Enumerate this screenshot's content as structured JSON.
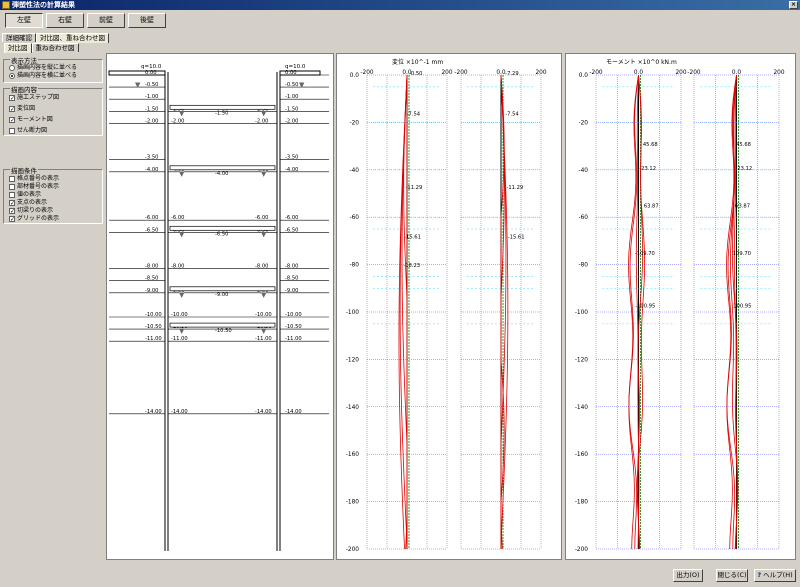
{
  "window": {
    "title": "弾塑性法の計算結果"
  },
  "walls": [
    "左壁",
    "右壁",
    "前壁",
    "後壁"
  ],
  "main_tabs": [
    "詳細確認",
    "対比図、重ね合わせ図"
  ],
  "sub_tabs": [
    "対比図",
    "重ね合わせ図"
  ],
  "display_method": {
    "title": "表示方法",
    "options": [
      {
        "label": "描画内容を縦に並べる",
        "selected": false
      },
      {
        "label": "描画内容を横に並べる",
        "selected": true
      }
    ]
  },
  "draw_content": {
    "title": "描画内容",
    "items": [
      {
        "label": "施工ステップ図",
        "checked": true
      },
      {
        "label": "変位図",
        "checked": true
      },
      {
        "label": "モーメント図",
        "checked": true
      },
      {
        "label": "せん断力図",
        "checked": false
      }
    ]
  },
  "draw_conditions": {
    "title": "描画条件",
    "items": [
      {
        "label": "格点番号の表示",
        "checked": false
      },
      {
        "label": "部材番号の表示",
        "checked": false
      },
      {
        "label": "値の表示",
        "checked": false
      },
      {
        "label": "支点の表示",
        "checked": true
      },
      {
        "label": "切梁りの表示",
        "checked": true
      },
      {
        "label": "グリッドの表示",
        "checked": true
      }
    ]
  },
  "step_diagram": {
    "surcharge": "q=10.0",
    "left_levels": [
      "0.00",
      "-0.50",
      "-1.00",
      "-1.50",
      "-2.00",
      "-3.50",
      "-4.00",
      "-6.00",
      "-6.50",
      "-8.00",
      "-8.50",
      "-9.00",
      "-10.00",
      "-10.50",
      "-11.00",
      "-14.00"
    ],
    "right_levels": [
      "0.00",
      "-0.50",
      "-1.00",
      "-1.50",
      "-2.00",
      "-3.50",
      "-4.00",
      "-6.00",
      "-6.50",
      "-8.00",
      "-8.50",
      "-9.00",
      "-10.00",
      "-10.50",
      "-11.00",
      "-14.00"
    ],
    "inner_labels": [
      "-1.50",
      "-2.00",
      "-4.00",
      "-6.00",
      "-6.50",
      "-9.00",
      "-10.00",
      "-10.50",
      "-11.00",
      "-14.00",
      "-8.00"
    ],
    "strut_labels": [
      "-1.50",
      "-4.00",
      "-6.50",
      "-9.00",
      "-10.50"
    ]
  },
  "chart_data": [
    {
      "type": "line",
      "title": "変位 ×10^-1 mm",
      "x_ticks": [
        "-200",
        "0.0",
        "200"
      ],
      "y_ticks": [
        "0.0",
        "-20",
        "-40",
        "-60",
        "-80",
        "-100",
        "-120",
        "-140",
        "-160",
        "-180",
        "-200"
      ],
      "xlim": [
        -200,
        200
      ],
      "ylim": [
        -200,
        0
      ],
      "grid": true,
      "annotations": [
        {
          "label": "-0.50",
          "x": 0,
          "y": 0
        },
        {
          "label": "-7.54",
          "x": -7.54,
          "y": -17
        },
        {
          "label": "-11.29",
          "x": -11.29,
          "y": -48
        },
        {
          "label": "-15.61",
          "x": -15.61,
          "y": -69
        },
        {
          "label": "-18.23",
          "x": -18.23,
          "y": -81
        },
        {
          "label": "-7.29",
          "x": -7.29,
          "y": 0
        },
        {
          "label": "-7.54",
          "x": -7.54,
          "y": -17
        },
        {
          "label": "-11.29",
          "x": -11.29,
          "y": -48
        },
        {
          "label": "-15.61",
          "x": -15.61,
          "y": -69
        }
      ]
    },
    {
      "type": "line",
      "title": "モーメント ×10^0 kN.m",
      "x_ticks": [
        "-200",
        "0.0",
        "200"
      ],
      "y_ticks": [
        "0.0",
        "-20",
        "-40",
        "-60",
        "-80",
        "-100",
        "-120",
        "-140",
        "-160",
        "-180",
        "-200"
      ],
      "xlim": [
        -200,
        200
      ],
      "ylim": [
        -200,
        0
      ],
      "grid": true,
      "annotations": [
        {
          "label": "45.68",
          "x": 45.68,
          "y": -30
        },
        {
          "label": "-23.12",
          "x": -23.12,
          "y": -40
        },
        {
          "label": "63.87",
          "x": 63.87,
          "y": -56
        },
        {
          "label": "-109.70",
          "x": -109.7,
          "y": -76
        },
        {
          "label": "-100.95",
          "x": -100.95,
          "y": -98
        },
        {
          "label": "45.68",
          "x": 45.68,
          "y": -30
        },
        {
          "label": "23.12",
          "x": 23.12,
          "y": -40
        },
        {
          "label": "63.87",
          "x": 63.87,
          "y": -56
        },
        {
          "label": "109.70",
          "x": 109.7,
          "y": -76
        },
        {
          "label": "100.95",
          "x": 100.95,
          "y": -98
        }
      ]
    }
  ],
  "footer": {
    "output": "出力(O)",
    "close": "閉じる(C)",
    "help": "ヘルプ(H)"
  }
}
